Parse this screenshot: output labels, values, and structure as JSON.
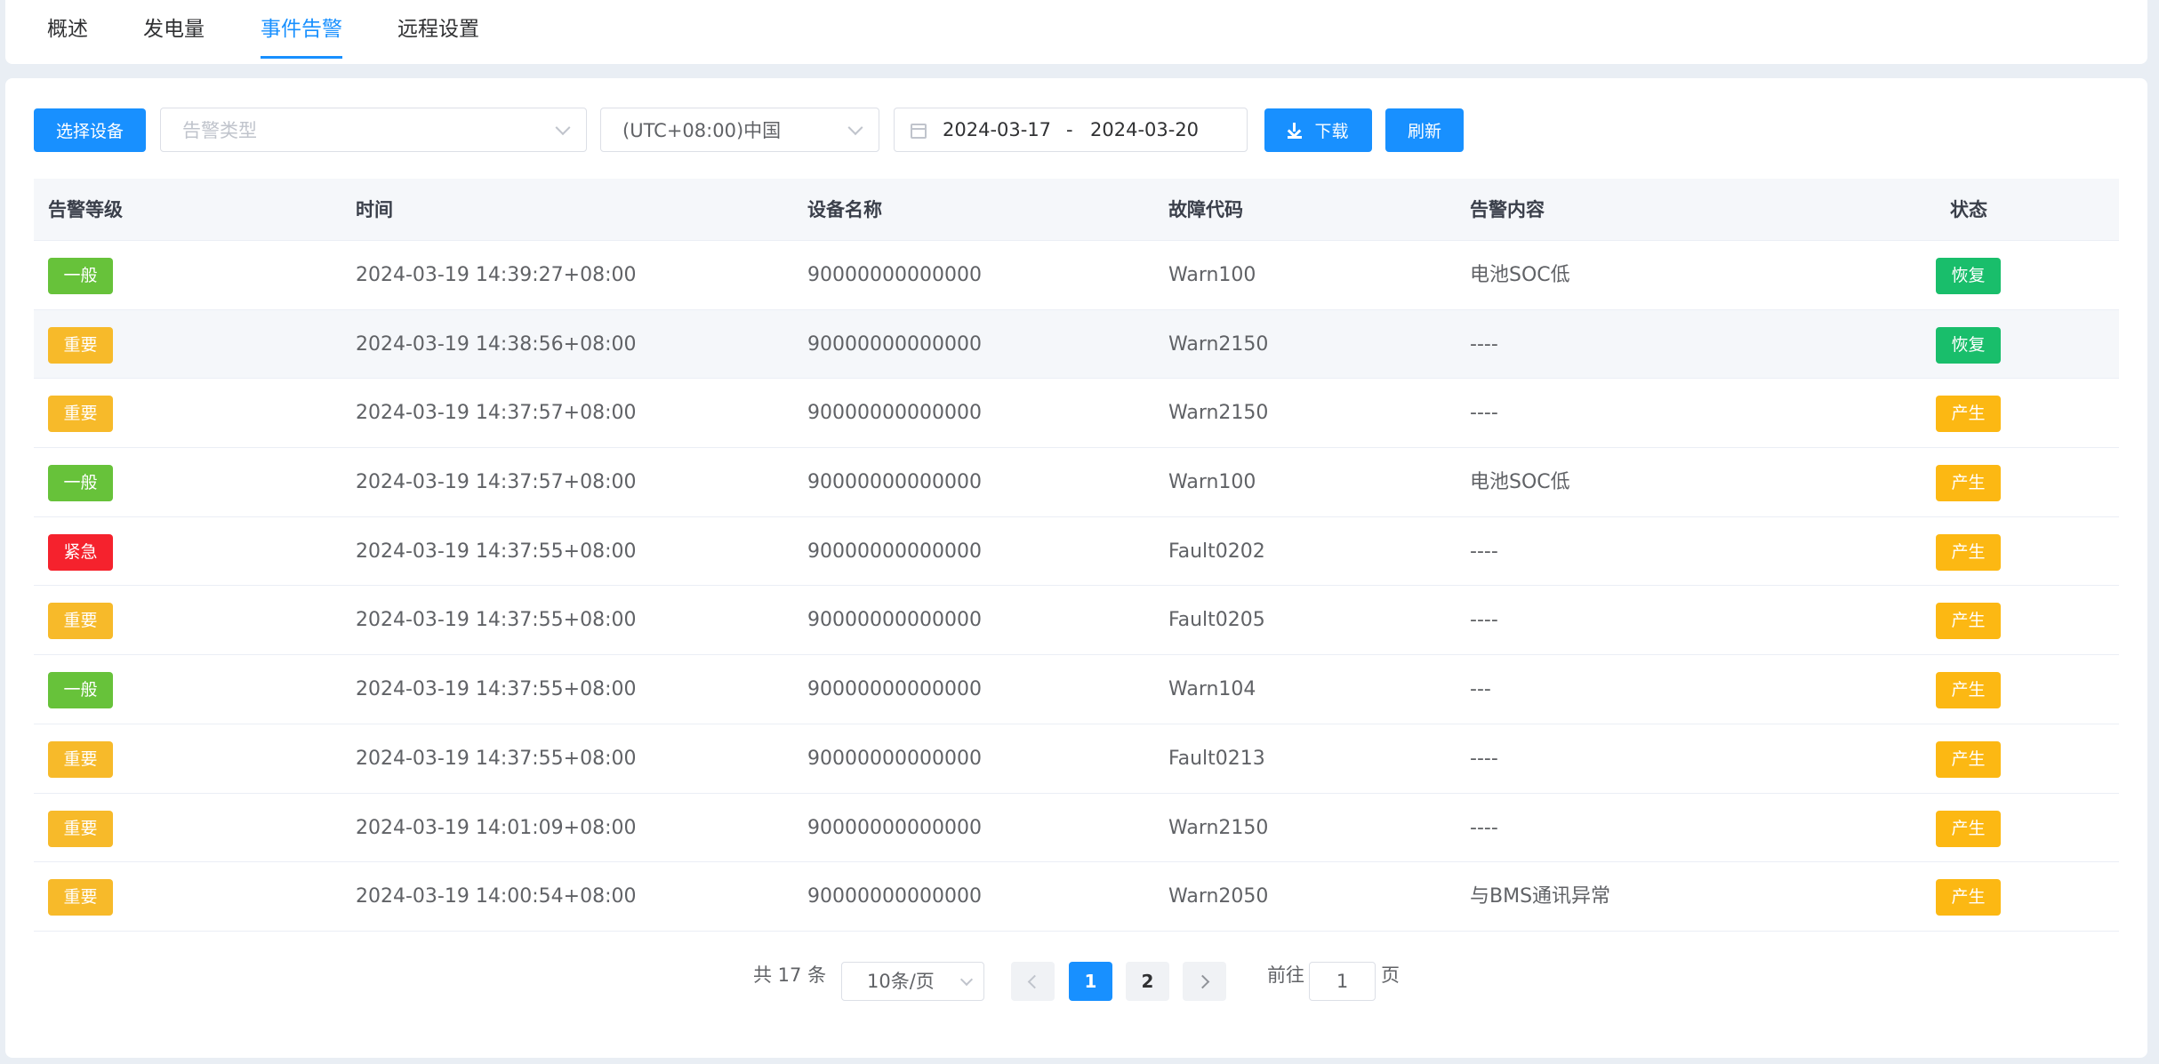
{
  "tabs": [
    {
      "label": "概述"
    },
    {
      "label": "发电量"
    },
    {
      "label": "事件告警"
    },
    {
      "label": "远程设置"
    }
  ],
  "active_tab": "事件告警",
  "toolbar": {
    "select_device": "选择设备",
    "alarm_type_placeholder": "告警类型",
    "timezone": "(UTC+08:00)中国",
    "date_start": "2024-03-17",
    "date_separator": "-",
    "date_end": "2024-03-20",
    "download": "下载",
    "refresh": "刷新"
  },
  "table": {
    "columns": [
      "告警等级",
      "时间",
      "设备名称",
      "故障代码",
      "告警内容",
      "状态"
    ],
    "rows": [
      {
        "level": "一般",
        "time": "2024-03-19 14:39:27+08:00",
        "device": "90000000000000",
        "code": "Warn100",
        "content": "电池SOC低",
        "status": "恢复"
      },
      {
        "level": "重要",
        "time": "2024-03-19 14:38:56+08:00",
        "device": "90000000000000",
        "code": "Warn2150",
        "content": "----",
        "status": "恢复"
      },
      {
        "level": "重要",
        "time": "2024-03-19 14:37:57+08:00",
        "device": "90000000000000",
        "code": "Warn2150",
        "content": "----",
        "status": "产生"
      },
      {
        "level": "一般",
        "time": "2024-03-19 14:37:57+08:00",
        "device": "90000000000000",
        "code": "Warn100",
        "content": "电池SOC低",
        "status": "产生"
      },
      {
        "level": "紧急",
        "time": "2024-03-19 14:37:55+08:00",
        "device": "90000000000000",
        "code": "Fault0202",
        "content": "----",
        "status": "产生"
      },
      {
        "level": "重要",
        "time": "2024-03-19 14:37:55+08:00",
        "device": "90000000000000",
        "code": "Fault0205",
        "content": "----",
        "status": "产生"
      },
      {
        "level": "一般",
        "time": "2024-03-19 14:37:55+08:00",
        "device": "90000000000000",
        "code": "Warn104",
        "content": "---",
        "status": "产生"
      },
      {
        "level": "重要",
        "time": "2024-03-19 14:37:55+08:00",
        "device": "90000000000000",
        "code": "Fault0213",
        "content": "----",
        "status": "产生"
      },
      {
        "level": "重要",
        "time": "2024-03-19 14:01:09+08:00",
        "device": "90000000000000",
        "code": "Warn2150",
        "content": "----",
        "status": "产生"
      },
      {
        "level": "重要",
        "time": "2024-03-19 14:00:54+08:00",
        "device": "90000000000000",
        "code": "Warn2050",
        "content": "与BMS通讯异常",
        "status": "产生"
      }
    ]
  },
  "colors": {
    "primary": "#1890ff",
    "level_general": "#67c23a",
    "level_important": "#f7ba2a",
    "level_urgent": "#f5222d",
    "status_recovered": "#19be6b",
    "status_occurred": "#fcb813"
  },
  "pagination": {
    "total": "共 17 条",
    "page_size": "10条/页",
    "pages": [
      "1",
      "2"
    ],
    "current_page": "1",
    "goto_prefix": "前往",
    "goto_value": "1",
    "goto_suffix": "页"
  }
}
